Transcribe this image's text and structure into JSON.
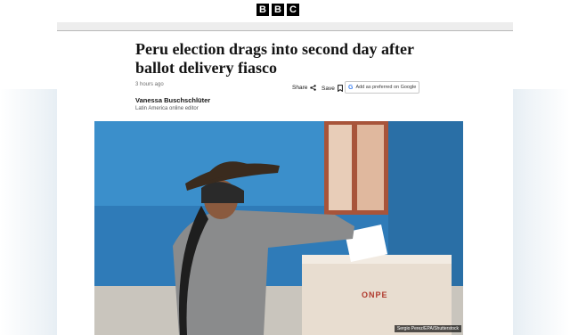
{
  "brand": {
    "letters": [
      "B",
      "B",
      "C"
    ]
  },
  "article": {
    "headline": "Peru election drags into second day after ballot delivery fiasco",
    "timestamp": "3 hours ago",
    "author": {
      "name": "Vanessa Buschschlüter",
      "role": "Latin America online editor"
    },
    "actions": {
      "share_label": "Share",
      "save_label": "Save",
      "preferred_label": "Add as preferred on Google"
    },
    "image": {
      "credit": "Sergio Perez/EPA/Shutterstock",
      "box_label": "ONPE"
    }
  },
  "icons": {
    "share": "share-icon",
    "save": "bookmark-icon",
    "google": "google-icon"
  },
  "colors": {
    "wall_blue": "#2f7bb8",
    "text": "#141414",
    "background": "#ffffff"
  }
}
